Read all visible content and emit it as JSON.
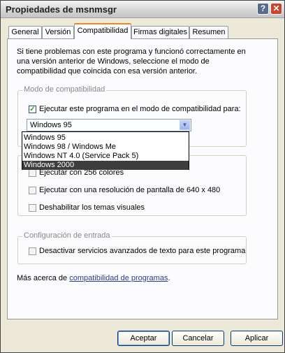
{
  "window": {
    "title": "Propiedades de msnmsgr",
    "help_label": "?",
    "close_label": "✕"
  },
  "tabs": [
    {
      "label": "General"
    },
    {
      "label": "Versión"
    },
    {
      "label": "Compatibilidad"
    },
    {
      "label": "Firmas digitales"
    },
    {
      "label": "Resumen"
    }
  ],
  "intro": {
    "line1": "Si tiene problemas con este programa y funcionó correctamente en",
    "line2": "una versión anterior de Windows, seleccione el modo de",
    "line3": "compatibilidad que coincida con esa versión anterior."
  },
  "compat_mode": {
    "legend": "Modo de compatibilidad",
    "checkbox_label": "Ejecutar este programa en el modo de compatibilidad para:",
    "checked": true,
    "selected": "Windows 95",
    "options": [
      "Windows 95",
      "Windows 98 / Windows Me",
      "Windows NT 4.0 (Service Pack 5)",
      "Windows 2000"
    ],
    "highlighted": "Windows 2000"
  },
  "display": {
    "legend_visible": "C",
    "items": [
      {
        "label": "Ejecutar con 256 colores"
      },
      {
        "label": "Ejecutar con una resolución de pantalla de 640 x 480"
      },
      {
        "label": "Deshabilitar los temas visuales"
      }
    ]
  },
  "input": {
    "legend": "Configuración de entrada",
    "checkbox_label": "Desactivar servicios avanzados de texto para este programa"
  },
  "footer": {
    "more_prefix": "Más acerca de ",
    "more_link": "compatibilidad de programas",
    "more_suffix": "."
  },
  "buttons": {
    "ok": "Aceptar",
    "cancel": "Cancelar",
    "apply": "Aplicar"
  }
}
